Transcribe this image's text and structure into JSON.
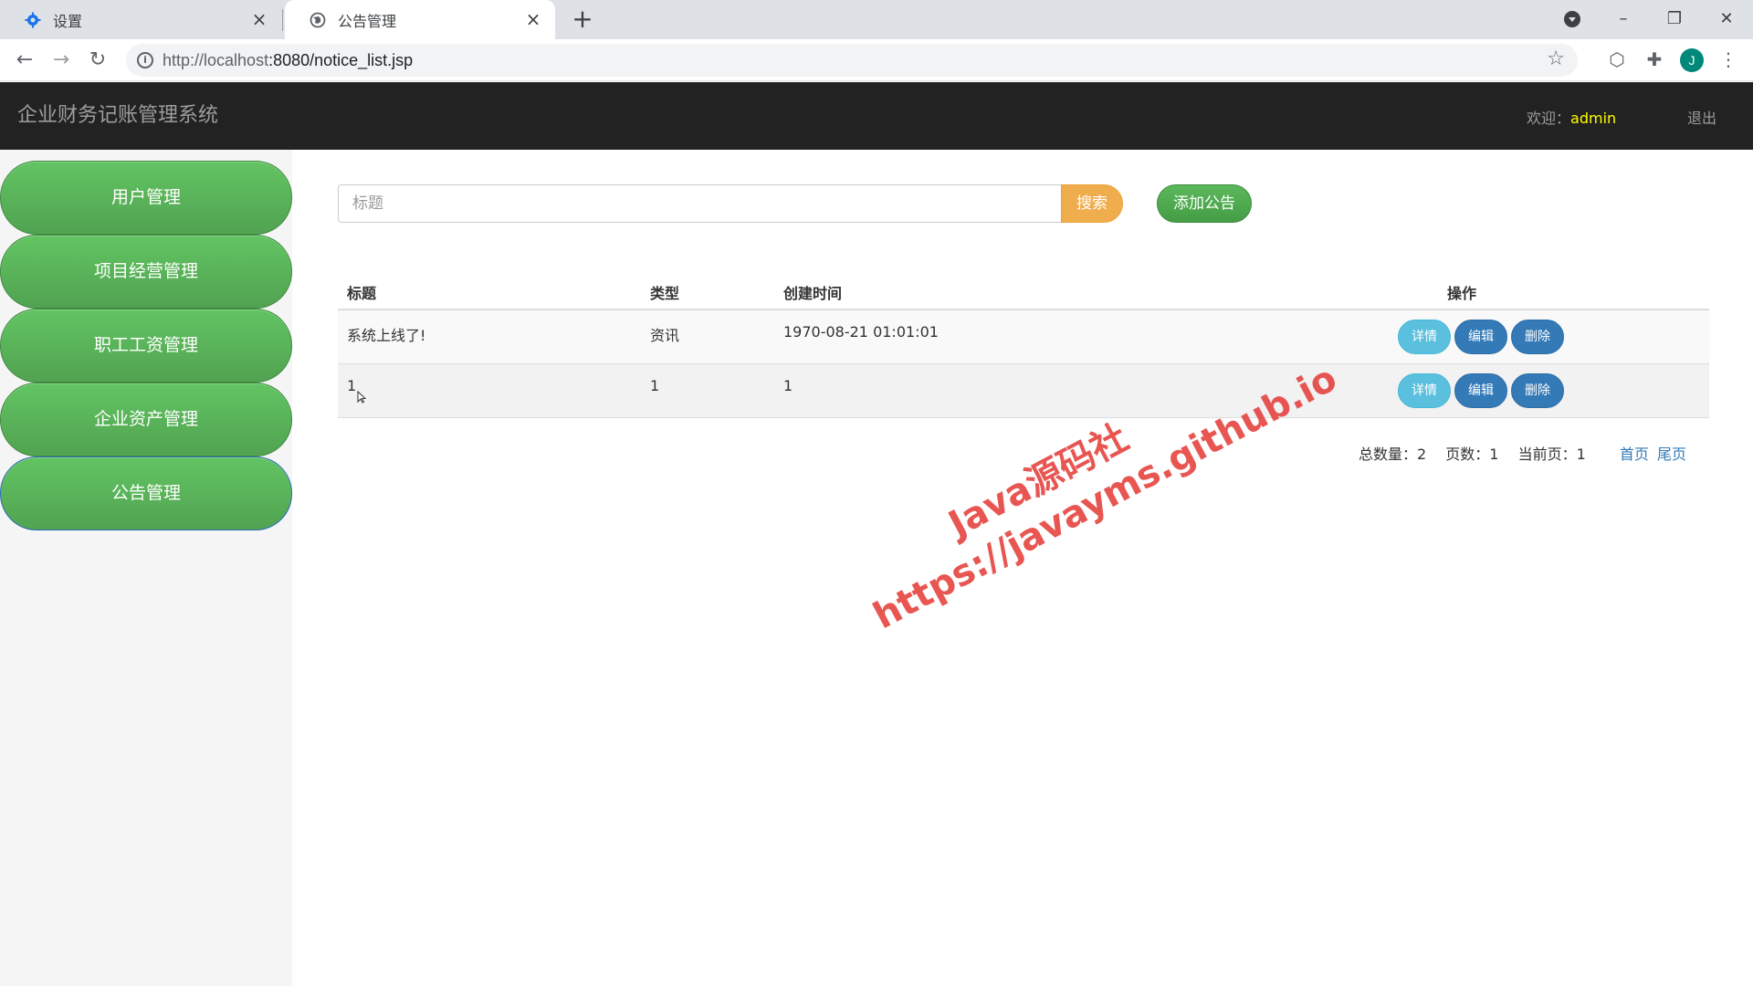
{
  "browser": {
    "tabs": [
      {
        "title": "设置",
        "icon": "gear-icon"
      },
      {
        "title": "公告管理",
        "icon": "globe-icon"
      }
    ],
    "url_host": "http://localhost",
    "url_rest": ":8080/notice_list.jsp",
    "avatar_letter": "J"
  },
  "header": {
    "app_title": "企业财务记账管理系统",
    "welcome_label": "欢迎：",
    "username": "admin",
    "logout": "退出"
  },
  "sidebar": {
    "items": [
      {
        "label": "用户管理"
      },
      {
        "label": "项目经营管理"
      },
      {
        "label": "职工工资管理"
      },
      {
        "label": "企业资产管理"
      },
      {
        "label": "公告管理"
      }
    ]
  },
  "search": {
    "placeholder": "标题",
    "button": "搜索",
    "add_button": "添加公告"
  },
  "table": {
    "headers": {
      "title": "标题",
      "type": "类型",
      "created": "创建时间",
      "ops": "操作"
    },
    "rows": [
      {
        "title": "系统上线了!",
        "type": "资讯",
        "created": "1970-08-21 01:01:01"
      },
      {
        "title": "1",
        "type": "1",
        "created": "1"
      }
    ],
    "actions": {
      "detail": "详情",
      "edit": "编辑",
      "delete": "删除"
    }
  },
  "pager": {
    "total": "总数量：2",
    "pages": "页数：1",
    "current": "当前页：1",
    "first": "首页",
    "last": "尾页"
  },
  "watermark": {
    "line1": "Java源码社",
    "line2": "https://javayms.github.io"
  },
  "colors": {
    "header_bg": "#222222",
    "sidebar_green": "#5cb85c",
    "search_orange": "#f0ad4e",
    "info_blue": "#5bc0de",
    "primary_blue": "#337ab7",
    "username_yellow": "#ffff00"
  }
}
